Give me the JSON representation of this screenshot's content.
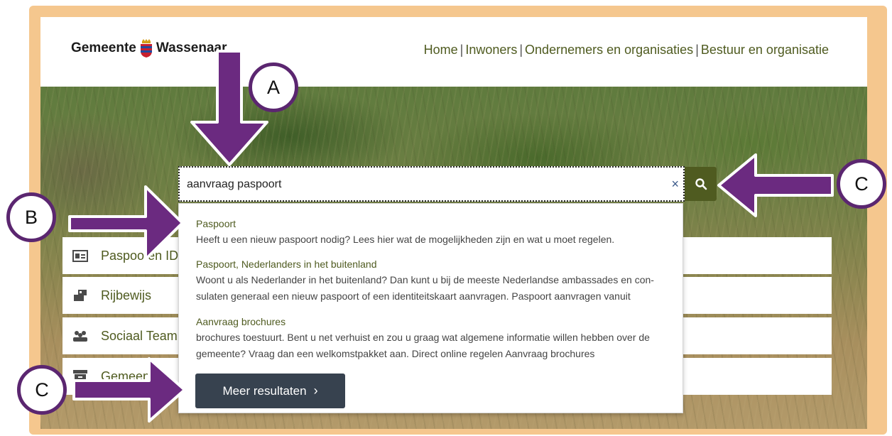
{
  "header": {
    "logo_left": "Gemeente",
    "logo_right": "Wassenaar",
    "nav": [
      "Home",
      "Inwoners",
      "Ondernemers en organisaties",
      "Bestuur en organisatie"
    ]
  },
  "search": {
    "value": "aanvraag paspoort",
    "clear_symbol": "×",
    "button_icon": "search-icon"
  },
  "suggestions": [
    {
      "title": "Paspoort",
      "lines": [
        "Heeft u een nieuw paspoort nodig? Lees hier wat de mogelijkheden zijn en wat u moet regelen."
      ]
    },
    {
      "title": "Paspoort, Nederlanders in het buitenland",
      "lines": [
        "Woont u als Nederlander in het buitenland? Dan kunt u bij de meeste Nederlandse ambassades en con-",
        "sulaten generaal een nieuw paspoort of een identiteitskaart aanvragen. Paspoort aanvragen vanuit"
      ]
    },
    {
      "title": "Aanvraag brochures",
      "lines": [
        "brochures toestuurt. Bent u net verhuist en zou u graag wat algemene informatie willen hebben over de",
        "gemeente? Vraag dan een welkomstpakket aan. Direct online regelen Aanvraag brochures"
      ]
    }
  ],
  "more_button": {
    "label": "Meer resultaten",
    "chevron": "›"
  },
  "tiles": [
    {
      "label": "Paspoo",
      "label_tail": " en ID",
      "icon": "id-card-icon"
    },
    {
      "label": "Rijbewijs",
      "icon": "license-icon"
    },
    {
      "label": "Sociaal Team",
      "icon": "people-icon"
    },
    {
      "label": "Gemeen",
      "icon": "archive-icon"
    }
  ],
  "annotations": {
    "a": "A",
    "b": "B",
    "c1": "C",
    "c2": "C"
  },
  "colors": {
    "accent": "#4f5b20",
    "frame": "#f5c78e",
    "arrow": "#6b2a80",
    "button_dark": "#37424f"
  }
}
